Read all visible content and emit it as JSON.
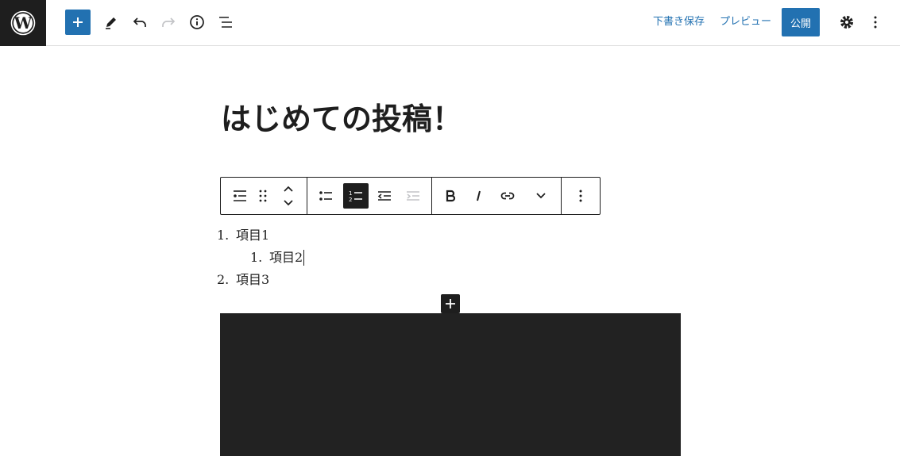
{
  "header": {
    "save_draft_label": "下書き保存",
    "preview_label": "プレビュー",
    "publish_label": "公開"
  },
  "post": {
    "title": "はじめての投稿！"
  },
  "list": {
    "items": [
      {
        "marker": "1.",
        "text": "項目1",
        "level": 0
      },
      {
        "marker": "1.",
        "text": "項目2",
        "level": 1
      },
      {
        "marker": "2.",
        "text": "項目3",
        "level": 0
      }
    ]
  },
  "icons": {
    "wp_logo": "wordpress-logo-icon",
    "add": "plus-icon",
    "tools": "pencil-icon",
    "undo": "undo-icon",
    "redo": "redo-icon",
    "details": "info-icon",
    "outline": "list-view-icon",
    "settings": "gear-icon",
    "options": "vertical-dots-icon"
  },
  "colors": {
    "accent": "#2271b1",
    "dark": "#1e1e1e",
    "disabled": "#a7aaad",
    "block_bg": "#222222"
  }
}
